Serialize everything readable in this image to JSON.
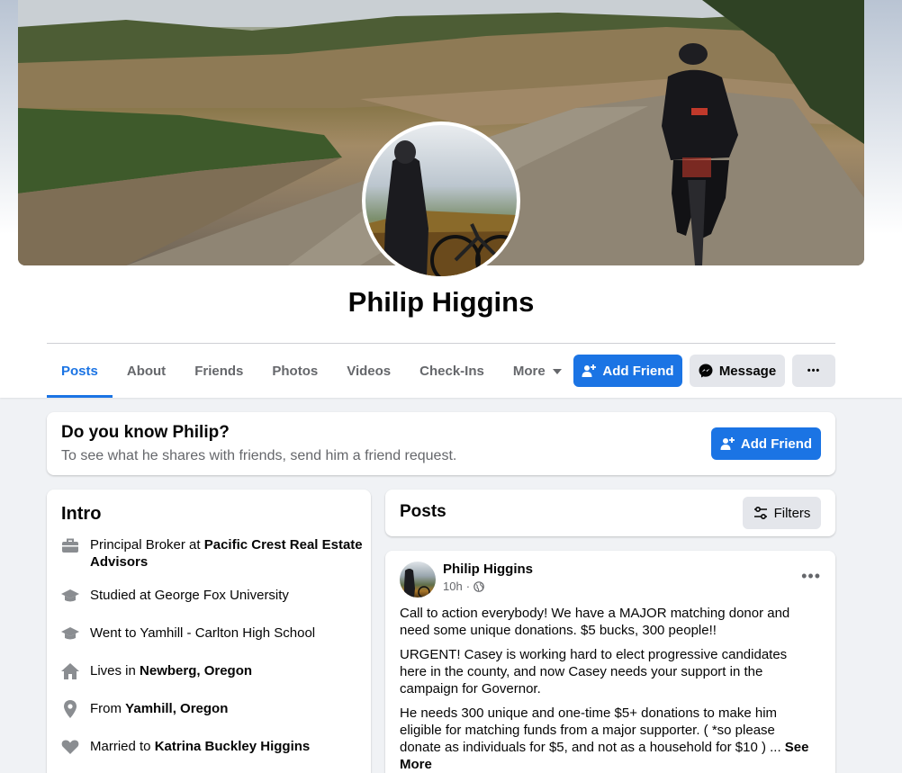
{
  "profile": {
    "name": "Philip Higgins"
  },
  "tabs": [
    {
      "label": "Posts"
    },
    {
      "label": "About"
    },
    {
      "label": "Friends"
    },
    {
      "label": "Photos"
    },
    {
      "label": "Videos"
    },
    {
      "label": "Check-Ins"
    },
    {
      "label": "More"
    }
  ],
  "actions": {
    "add_friend": "Add Friend",
    "message": "Message",
    "more_dots": "•••"
  },
  "know_card": {
    "title": "Do you know Philip?",
    "subtitle": "To see what he shares with friends, send him a friend request.",
    "button": "Add Friend"
  },
  "intro": {
    "title": "Intro",
    "work_prefix": "Principal Broker at ",
    "work_place": "Pacific Crest Real Estate Advisors",
    "studied": "Studied at George Fox University",
    "went": "Went to Yamhill - Carlton High School",
    "lives_prefix": "Lives in ",
    "lives_place": "Newberg, Oregon",
    "from_prefix": "From ",
    "from_place": "Yamhill, Oregon",
    "married_prefix": "Married to ",
    "married_person": "Katrina Buckley Higgins"
  },
  "posts_header": {
    "title": "Posts",
    "filters": "Filters"
  },
  "post": {
    "author": "Philip Higgins",
    "time": "10h",
    "dot": "·",
    "menu": "•••",
    "para1": "Call to action everybody!  We have a MAJOR matching donor and need some unique donations. $5 bucks, 300 people!!",
    "para2": "URGENT! Casey is working hard to elect progressive candidates here in the county, and now Casey needs your support in the campaign for Governor.",
    "para3": "He needs 300 unique and one-time $5+ donations to make him eligible for matching funds from a major supporter. ( *so please donate as individuals for $5, and not as a household for $10 ) ... ",
    "see_more": "See More"
  },
  "colors": {
    "accent": "#1b74e4",
    "secondary_text": "#65676b",
    "icon_gray": "#8a8d91"
  }
}
